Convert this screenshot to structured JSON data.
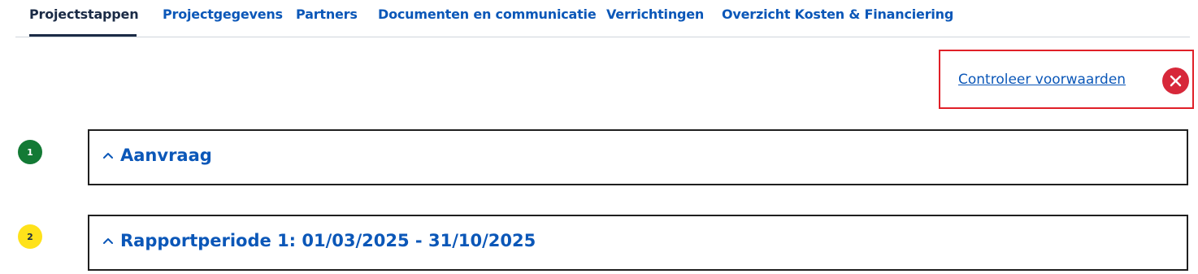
{
  "tabs": [
    {
      "label": "Projectstappen",
      "active": true
    },
    {
      "label": "Projectgegevens",
      "active": false
    },
    {
      "label": "Partners",
      "active": false
    },
    {
      "label": "Documenten en communicatie",
      "active": false
    },
    {
      "label": "Verrichtingen",
      "active": false
    },
    {
      "label": "Overzicht Kosten & Financiering",
      "active": false
    }
  ],
  "check": {
    "link_label": "Controleer voorwaarden",
    "status_icon": "close-circle-icon",
    "status_color": "#d7283a"
  },
  "steps": [
    {
      "number": "1",
      "title": "Aanvraag",
      "badge_color": "#137a35",
      "expand_icon": "chevron-up-icon"
    },
    {
      "number": "2",
      "title": "Rapportperiode 1: 01/03/2025 - 31/10/2025",
      "badge_color": "#ffe21a",
      "expand_icon": "chevron-up-icon"
    }
  ],
  "colors": {
    "link": "#0b57b8",
    "active_tab": "#1b2b46",
    "highlight_border": "#e02028"
  }
}
